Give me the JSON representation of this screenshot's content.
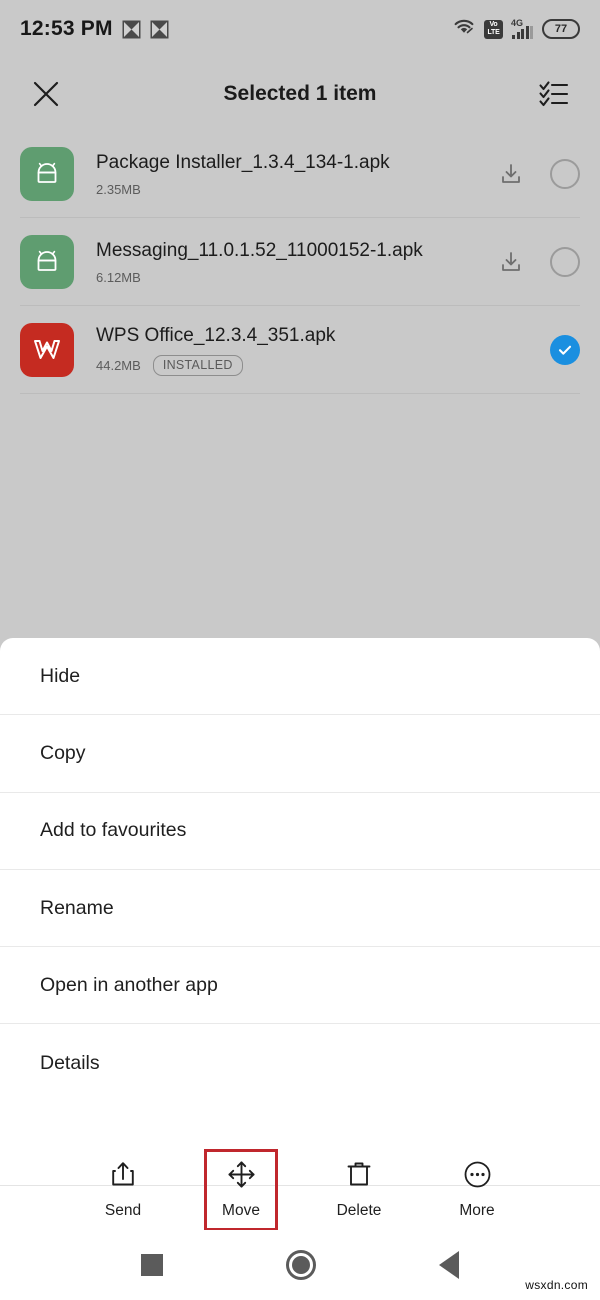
{
  "status_bar": {
    "time": "12:53 PM",
    "notification_icons": [
      "app-notification-icon",
      "app-notification-icon"
    ],
    "wifi_icon": "wifi-icon",
    "volte_top": "Vo",
    "volte_bottom": "LTE",
    "network_type": "4G",
    "battery_level": "77"
  },
  "header": {
    "close_icon": "close-icon",
    "title": "Selected 1 item",
    "select_all_icon": "select-all-icon"
  },
  "files": [
    {
      "name": "Package Installer_1.3.4_134-1.apk",
      "size": "2.35MB",
      "badge": "",
      "icon": "android-apk-icon",
      "icon_color": "#5f9d70",
      "has_download": true,
      "selected": false
    },
    {
      "name": "Messaging_11.0.1.52_11000152-1.apk",
      "size": "6.12MB",
      "badge": "",
      "icon": "android-apk-icon",
      "icon_color": "#5f9d70",
      "has_download": true,
      "selected": false
    },
    {
      "name": "WPS Office_12.3.4_351.apk",
      "size": "44.2MB",
      "badge": "INSTALLED",
      "icon": "wps-office-icon",
      "icon_color": "#c52b21",
      "has_download": false,
      "selected": true
    }
  ],
  "menu": {
    "items": [
      {
        "label": "Hide"
      },
      {
        "label": "Copy"
      },
      {
        "label": "Add to favourites"
      },
      {
        "label": "Rename"
      },
      {
        "label": "Open in another app"
      },
      {
        "label": "Details"
      }
    ]
  },
  "action_bar": {
    "items": [
      {
        "label": "Send",
        "icon": "share-icon",
        "highlighted": false
      },
      {
        "label": "Move",
        "icon": "move-arrows-icon",
        "highlighted": true
      },
      {
        "label": "Delete",
        "icon": "trash-icon",
        "highlighted": false
      },
      {
        "label": "More",
        "icon": "more-dots-icon",
        "highlighted": false
      }
    ],
    "highlight_color": "#c0272d"
  },
  "nav_bar": {
    "recents_icon": "recents-square-icon",
    "home_icon": "home-circle-icon",
    "back_icon": "back-triangle-icon"
  },
  "watermark": "wsxdn.com",
  "colors": {
    "background": "#c9c9c9",
    "sheet": "#ffffff",
    "accent_selected": "#1a8fe0",
    "annotation": "#c0272d"
  }
}
